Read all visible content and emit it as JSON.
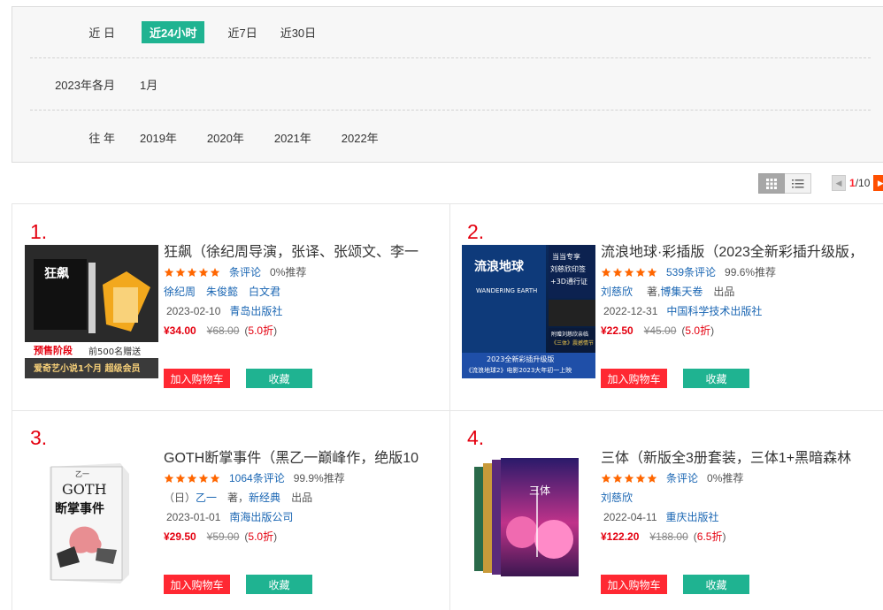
{
  "filters": {
    "rows": [
      {
        "label": "近 日",
        "options": [
          "近24小时",
          "近7日",
          "近30日"
        ],
        "active": 0
      },
      {
        "label": "2023年各月",
        "options": [
          "1月"
        ],
        "active": -1
      },
      {
        "label": "往 年",
        "options": [
          "2019年",
          "2020年",
          "2021年",
          "2022年"
        ],
        "active": -1
      }
    ]
  },
  "toolbar": {
    "view_grid_icon": "grid-view-icon",
    "view_list_icon": "list-view-icon",
    "pager": {
      "current": "1",
      "total": "/10"
    }
  },
  "colors": {
    "accent_green": "#1fb391",
    "accent_red": "#ff2832",
    "rank_red": "#e4000f",
    "link_blue": "#1a66b3",
    "star": "#ff6600"
  },
  "buttons": {
    "cart": "加入购物车",
    "fav": "收藏"
  },
  "books": [
    {
      "rank": "1.",
      "title": "狂飙（徐纪周导演，张译、张颂文、李一",
      "reviews": "条评论",
      "recommend": "0%推荐",
      "authors": [
        "徐纪周",
        "朱俊懿",
        "白文君"
      ],
      "date": "2023-02-10",
      "publisher": "青岛出版社",
      "price": "¥34.00",
      "orig": "¥68.00",
      "disc_open": "(",
      "disc": "5.0折",
      "disc_close": ")",
      "cover_text": {
        "title": "狂飙",
        "promo1": "预售阶段",
        "promo2": "前500名赠送",
        "promo3": "爱奇艺小说1个月 超级会员"
      }
    },
    {
      "rank": "2.",
      "title": "流浪地球·彩插版（2023全新彩插升级版，",
      "reviews": "539条评论",
      "recommend": "99.6%推荐",
      "authors": [
        "刘慈欣"
      ],
      "role1": "著,",
      "authors2": [
        "博集天卷"
      ],
      "role2": "出品",
      "date": "2022-12-31",
      "publisher": "中国科学技术出版社",
      "price": "¥22.50",
      "orig": "¥45.00",
      "disc_open": "(",
      "disc": "5.0折",
      "disc_close": ")",
      "cover_text": {
        "title": "流浪地球",
        "en": "WANDERING EARTH",
        "badge1": "当当专享",
        "badge2": "刘慈欣印签",
        "badge3": "+3D通行证",
        "badge4": "附赠刘慈欣亲临",
        "badge5": "《三体》震撼情节",
        "band1": "2023全新彩插升级版",
        "band2": "《流浪地球2》电影2023大年初一上映"
      }
    },
    {
      "rank": "3.",
      "title": "GOTH断掌事件（黑乙一巅峰作，绝版10",
      "reviews": "1064条评论",
      "recommend": "99.9%推荐",
      "prefix": "（日）",
      "authors": [
        "乙一"
      ],
      "role1": "著，",
      "authors2": [
        "新经典"
      ],
      "role2": "出品",
      "date": "2023-01-01",
      "publisher": "南海出版公司",
      "price": "¥29.50",
      "orig": "¥59.00",
      "disc_open": "(",
      "disc": "5.0折",
      "disc_close": ")",
      "cover_text": {
        "author": "乙一",
        "en": "GOTH",
        "title": "断掌事件"
      }
    },
    {
      "rank": "4.",
      "title": "三体（新版全3册套装，三体1+黑暗森林",
      "reviews": "条评论",
      "recommend": "0%推荐",
      "authors": [
        "刘慈欣"
      ],
      "date": "2022-04-11",
      "publisher": "重庆出版社",
      "price": "¥122.20",
      "orig": "¥188.00",
      "disc_open": "(",
      "disc": "6.5折",
      "disc_close": ")",
      "cover_text": {
        "title": "三体"
      }
    }
  ]
}
